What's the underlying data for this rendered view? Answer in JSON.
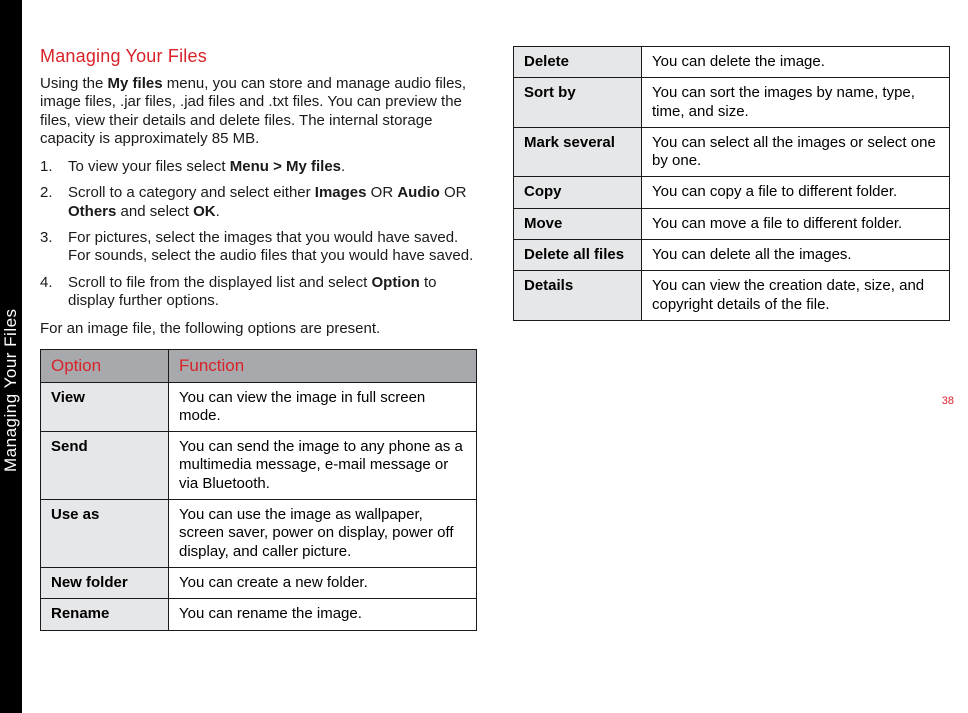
{
  "sideLabel": "Managing Your Files",
  "pageNumber": "38",
  "title": "Managing Your Files",
  "intro": {
    "pre": "Using the ",
    "b1": "My files",
    "post": " menu, you can store and manage audio files, image files, .jar files, .jad files and .txt files. You can preview the files, view their details and delete files. The internal storage capacity is approximately 85 MB."
  },
  "steps": [
    {
      "pre": "To view your files select ",
      "b1": "Menu > My files",
      "post": "."
    },
    {
      "pre": "Scroll to a category and select either ",
      "b1": "Images",
      "mid1": " OR ",
      "b2": "Audio",
      "mid2": " OR ",
      "b3": "Others",
      "mid3": " and select ",
      "b4": "OK",
      "post": "."
    },
    {
      "pre": "For pictures, select the images that you would have saved. For sounds, select the audio files that you would have saved.",
      "b1": "",
      "post": ""
    },
    {
      "pre": "Scroll to file from the displayed list and select ",
      "b1": "Option",
      "post": " to display further options."
    }
  ],
  "leadText": "For an image file, the following options are present.",
  "headers": {
    "option": "Option",
    "function": "Function"
  },
  "rows1": [
    {
      "opt": "View",
      "fn": "You can view the image in full screen mode."
    },
    {
      "opt": "Send",
      "fn": "You can send the image to any phone as a multimedia message, e-mail message or via Bluetooth."
    },
    {
      "opt": "Use as",
      "fn": "You can use the image as wallpaper, screen saver, power on display, power off display, and caller picture."
    },
    {
      "opt": "New folder",
      "fn": "You can create a new folder."
    },
    {
      "opt": "Rename",
      "fn": "You can rename the image."
    }
  ],
  "rows2": [
    {
      "opt": "Delete",
      "fn": "You can delete the image."
    },
    {
      "opt": "Sort by",
      "fn": "You can sort the images by name, type, time, and size."
    },
    {
      "opt": "Mark several",
      "fn": "You can select all the images or select one by one."
    },
    {
      "opt": "Copy",
      "fn": "You can copy a file to different folder."
    },
    {
      "opt": "Move",
      "fn": "You can move a file to different folder."
    },
    {
      "opt": "Delete all files",
      "fn": "You can delete all the images."
    },
    {
      "opt": "Details",
      "fn": "You can view the creation date, size, and copyright details of the file."
    }
  ]
}
